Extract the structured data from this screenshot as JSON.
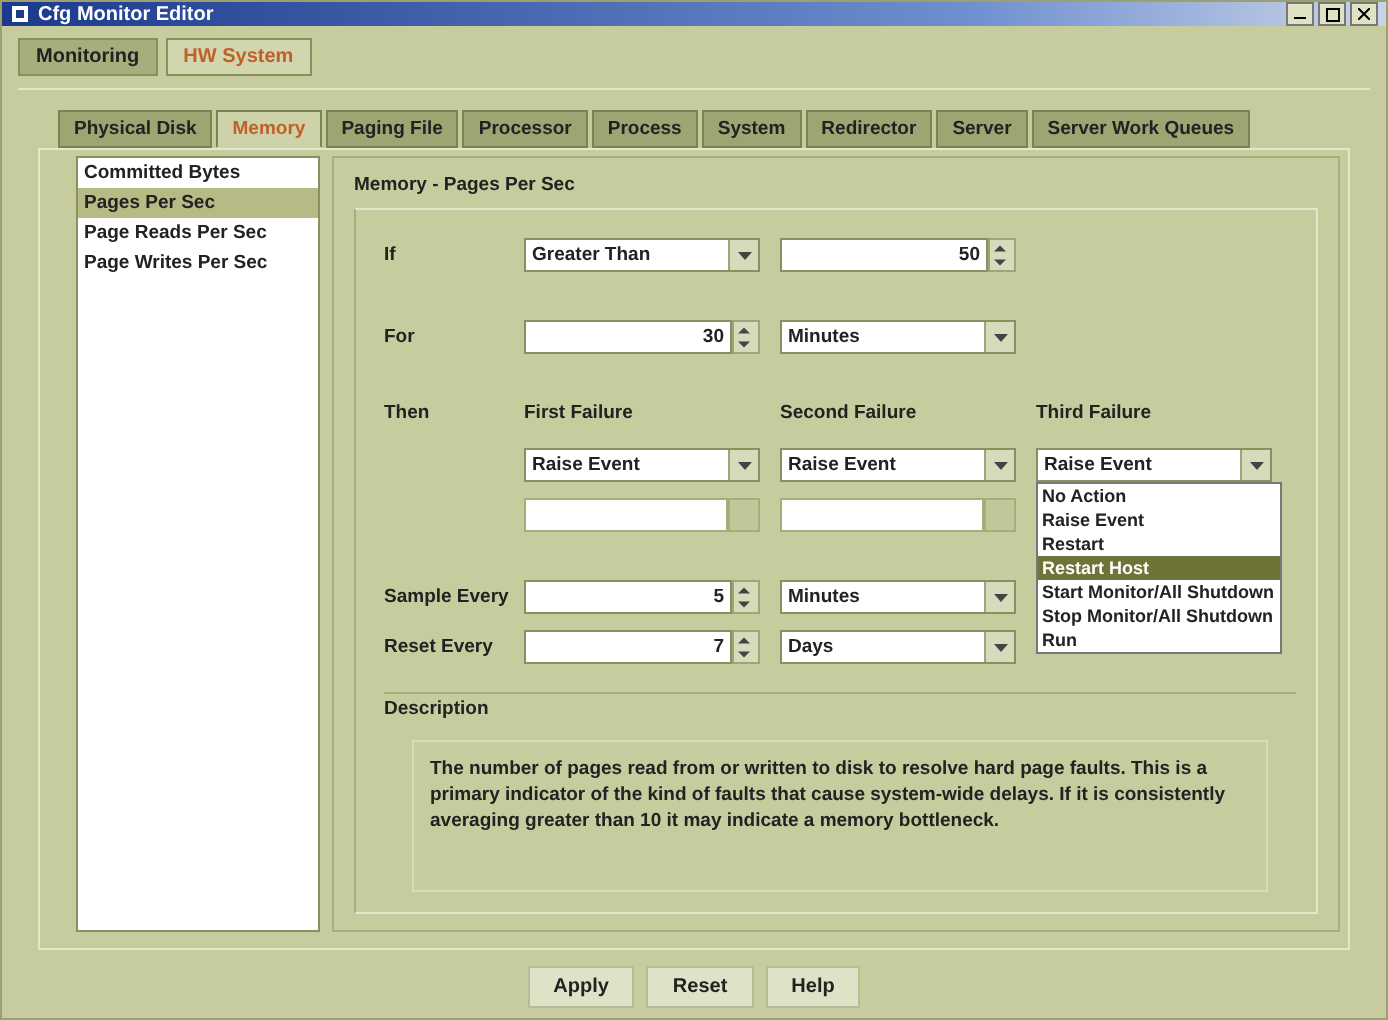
{
  "window": {
    "title": "Cfg Monitor Editor"
  },
  "top_tabs": [
    {
      "label": "Monitoring",
      "selected": false
    },
    {
      "label": "HW System",
      "selected": true
    }
  ],
  "sub_tabs": [
    {
      "label": "Physical Disk",
      "selected": false
    },
    {
      "label": "Memory",
      "selected": true
    },
    {
      "label": "Paging File",
      "selected": false
    },
    {
      "label": "Processor",
      "selected": false
    },
    {
      "label": "Process",
      "selected": false
    },
    {
      "label": "System",
      "selected": false
    },
    {
      "label": "Redirector",
      "selected": false
    },
    {
      "label": "Server",
      "selected": false
    },
    {
      "label": "Server Work Queues",
      "selected": false
    }
  ],
  "counters": [
    {
      "label": "Committed Bytes",
      "selected": false
    },
    {
      "label": "Pages Per Sec",
      "selected": true
    },
    {
      "label": "Page Reads Per Sec",
      "selected": false
    },
    {
      "label": "Page Writes Per Sec",
      "selected": false
    }
  ],
  "panel": {
    "title": "Memory - Pages Per Sec",
    "condition": {
      "label": "If",
      "operator": "Greater Than",
      "threshold": "50"
    },
    "duration": {
      "label": "For",
      "value": "30",
      "unit": "Minutes"
    },
    "actions": {
      "label": "Then",
      "columns": [
        {
          "heading": "First Failure",
          "value": "Raise Event"
        },
        {
          "heading": "Second Failure",
          "value": "Raise Event"
        },
        {
          "heading": "Third Failure",
          "value": "Raise Event"
        }
      ],
      "dropdown_options": [
        {
          "label": "No Action",
          "selected": false
        },
        {
          "label": "Raise Event",
          "selected": false
        },
        {
          "label": "Restart",
          "selected": false
        },
        {
          "label": "Restart Host",
          "selected": true
        },
        {
          "label": "Start Monitor/All Shutdown",
          "selected": false
        },
        {
          "label": "Stop Monitor/All Shutdown",
          "selected": false
        },
        {
          "label": "Run",
          "selected": false
        }
      ]
    },
    "sample_every": {
      "label": "Sample Every",
      "value": "5",
      "unit": "Minutes"
    },
    "reset_every": {
      "label": "Reset Every",
      "value": "7",
      "unit": "Days"
    },
    "description": {
      "heading": "Description",
      "text": "The number of pages read from or written to disk to resolve hard page faults. This is a primary indicator of the kind of faults that cause system-wide delays. If it is consistently averaging greater than 10 it may indicate a memory bottleneck."
    }
  },
  "buttons": [
    "Apply",
    "Reset",
    "Help"
  ]
}
